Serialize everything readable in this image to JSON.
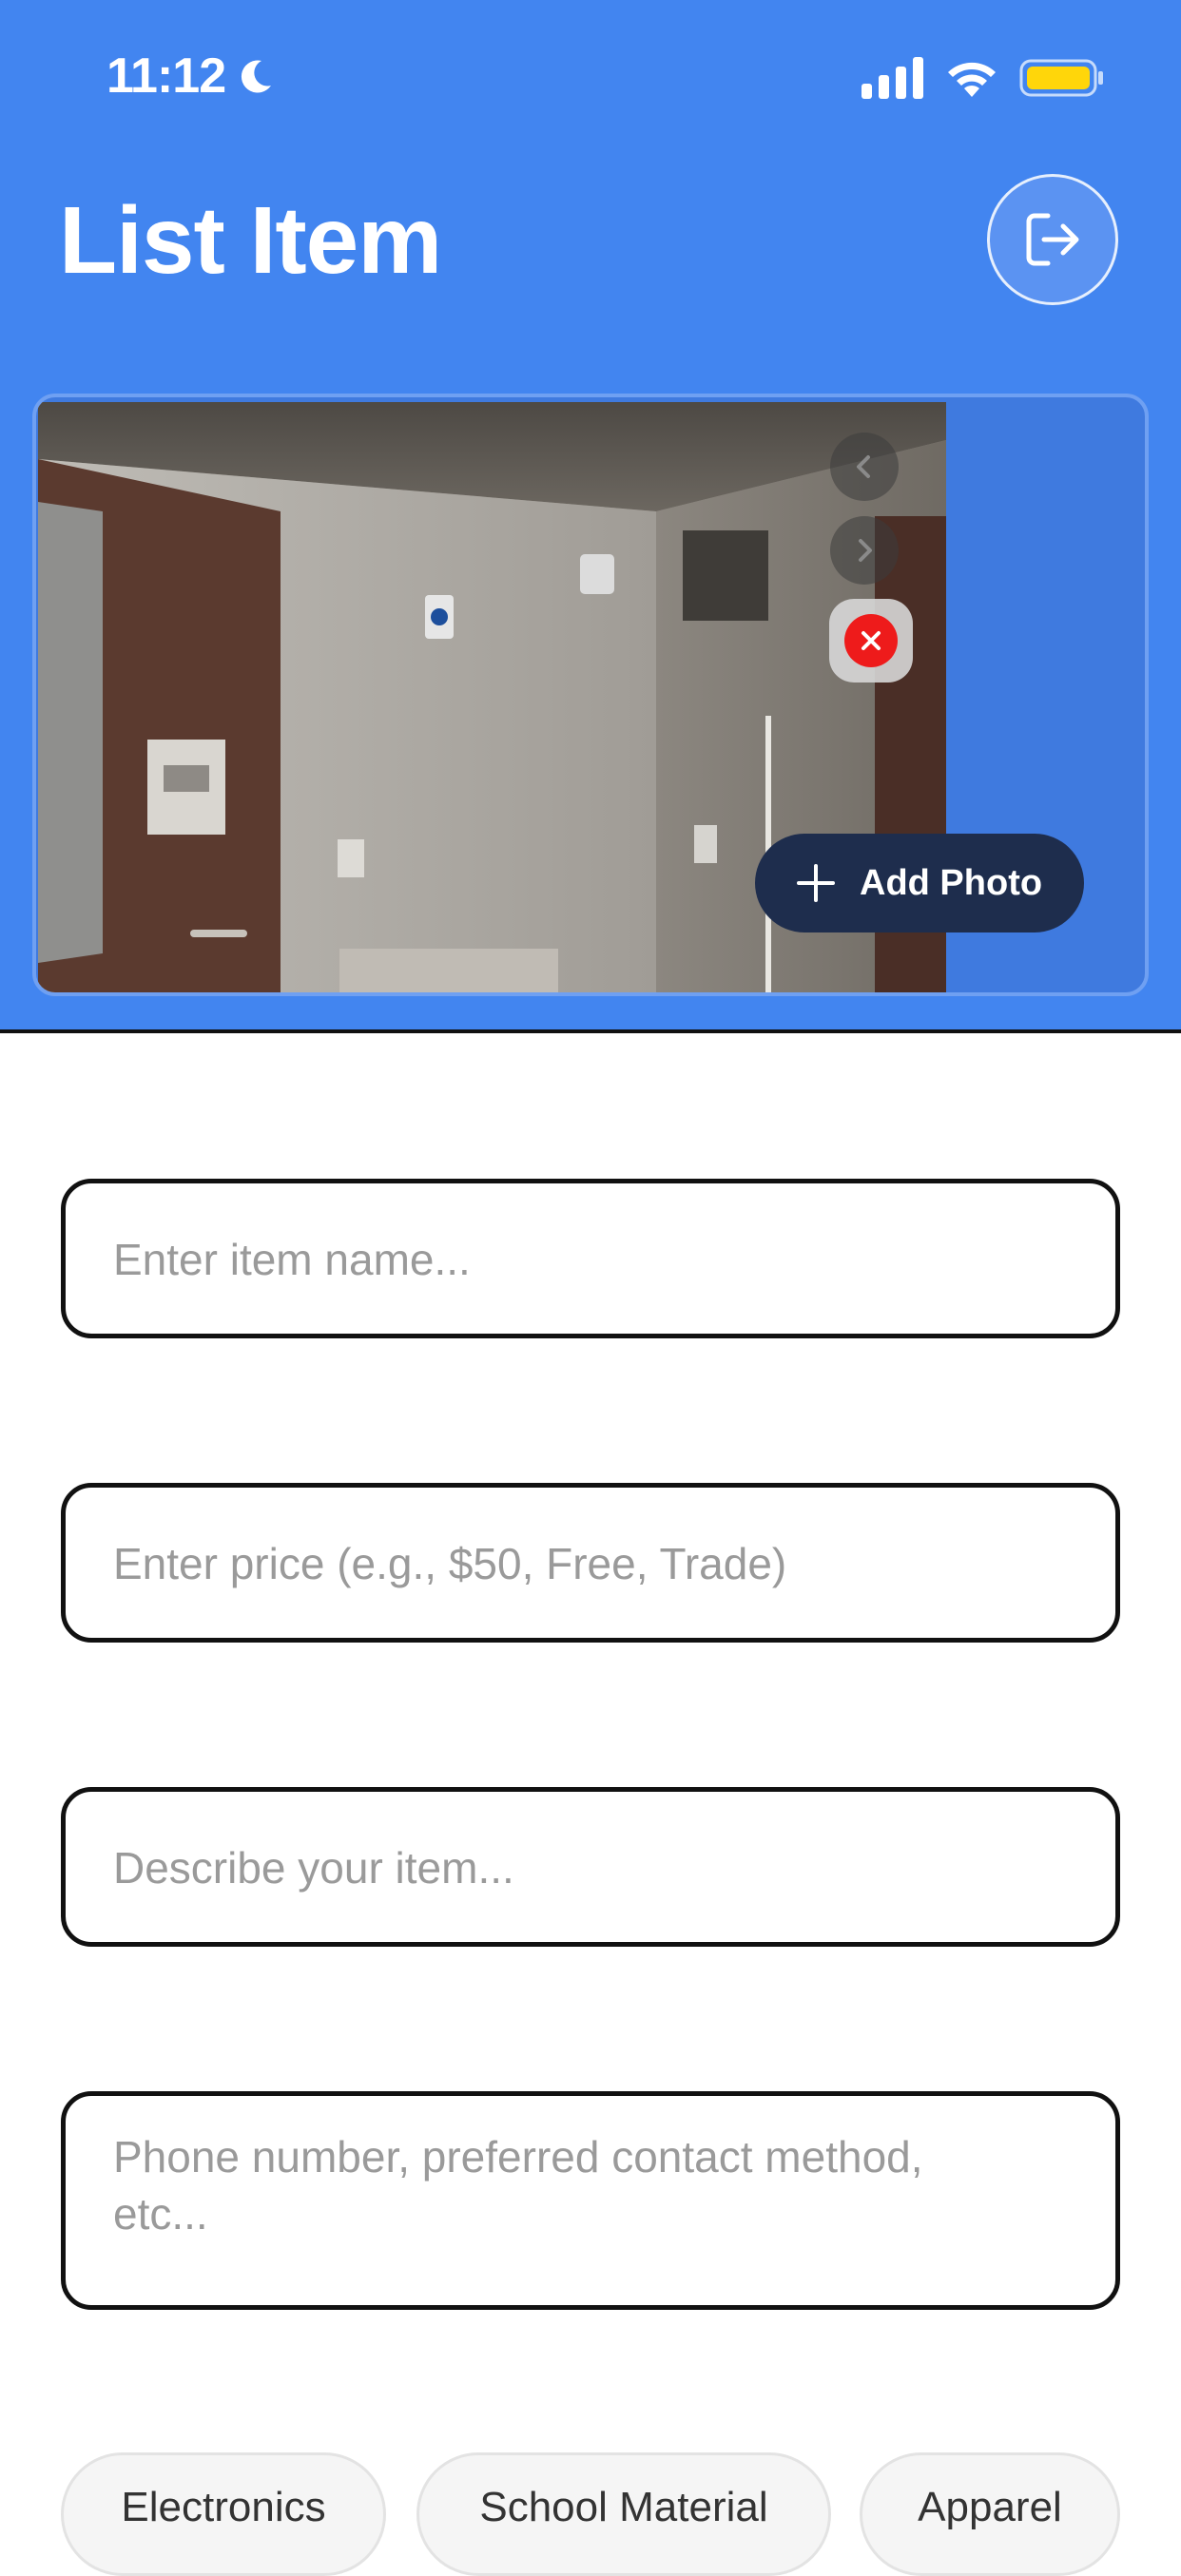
{
  "status_bar": {
    "time": "11:12",
    "icons": [
      "moon-icon",
      "cellular-signal-icon",
      "wifi-icon",
      "battery-icon"
    ],
    "battery_color": "#FFD60A"
  },
  "header": {
    "title": "List Item",
    "background_color": "#4285F0",
    "action_icon": "logout-icon"
  },
  "photos": {
    "add_photo_label": "Add Photo",
    "controls": [
      "chevron-left-icon",
      "chevron-right-icon",
      "close-icon"
    ]
  },
  "form": {
    "item_name_placeholder": "Enter item name...",
    "price_placeholder": "Enter price (e.g., $50, Free, Trade)",
    "description_placeholder": "Describe your item...",
    "contact_placeholder": "Phone number, preferred contact method, etc..."
  },
  "categories": [
    "Electronics",
    "School Material",
    "Apparel"
  ]
}
